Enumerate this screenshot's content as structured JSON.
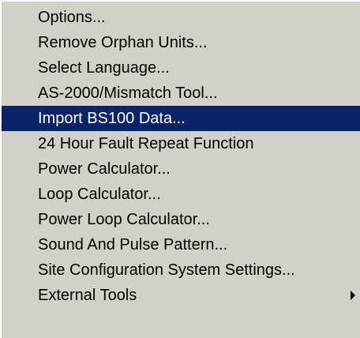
{
  "menu": {
    "items": [
      {
        "label": "Options...",
        "selected": false,
        "has_submenu": false
      },
      {
        "label": "Remove Orphan Units...",
        "selected": false,
        "has_submenu": false
      },
      {
        "label": "Select Language...",
        "selected": false,
        "has_submenu": false
      },
      {
        "label": "AS-2000/Mismatch Tool...",
        "selected": false,
        "has_submenu": false
      },
      {
        "label": "Import BS100 Data...",
        "selected": true,
        "has_submenu": false
      },
      {
        "label": "24 Hour Fault Repeat Function",
        "selected": false,
        "has_submenu": false
      },
      {
        "label": "Power Calculator...",
        "selected": false,
        "has_submenu": false
      },
      {
        "label": "Loop Calculator...",
        "selected": false,
        "has_submenu": false
      },
      {
        "label": "Power Loop Calculator...",
        "selected": false,
        "has_submenu": false
      },
      {
        "label": "Sound And Pulse Pattern...",
        "selected": false,
        "has_submenu": false
      },
      {
        "label": "Site Configuration System Settings...",
        "selected": false,
        "has_submenu": false
      },
      {
        "label": "External Tools",
        "selected": false,
        "has_submenu": true
      }
    ],
    "colors": {
      "background": "#d4d0c8",
      "highlight": "#0a246a",
      "highlight_text": "#ffffff",
      "text": "#000000"
    },
    "submenu_arrow_icon": "triangle-right-icon"
  }
}
